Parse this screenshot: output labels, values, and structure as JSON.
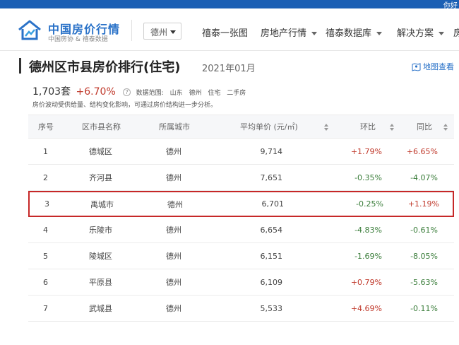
{
  "topbar": {
    "greeting": "你好"
  },
  "header": {
    "brand": "中国房价行情",
    "brand_sub": "中国房协 & 禧泰数据",
    "city_selected": "德州",
    "nav": [
      {
        "label": "禧泰一张图",
        "dropdown": false
      },
      {
        "label": "房地产行情",
        "dropdown": true
      },
      {
        "label": "禧泰数据库",
        "dropdown": true
      },
      {
        "label": "解决方案",
        "dropdown": true
      },
      {
        "label": "房",
        "dropdown": false
      }
    ]
  },
  "page": {
    "title": "德州区市县房价排行(住宅)",
    "date": "2021年01月",
    "map_link": "地图查看",
    "summary": {
      "count": "1,703套",
      "change": "+6.70%",
      "scope_label": "数据范围:",
      "scope": [
        "山东",
        "德州",
        "住宅",
        "二手房"
      ]
    },
    "note": "房价波动受供给量、结构变化影响，可通过房价结构进一步分析。"
  },
  "table": {
    "headers": {
      "rank": "序号",
      "area": "区市县名称",
      "city": "所属城市",
      "price": "平均单价 (元/㎡)",
      "mom": "环比",
      "yoy": "同比"
    },
    "rows": [
      {
        "rank": "1",
        "area": "德城区",
        "city": "德州",
        "price": "9,714",
        "mom": "+1.79%",
        "yoy": "+6.65%"
      },
      {
        "rank": "2",
        "area": "齐河县",
        "city": "德州",
        "price": "7,651",
        "mom": "-0.35%",
        "yoy": "-4.07%"
      },
      {
        "rank": "3",
        "area": "禹城市",
        "city": "德州",
        "price": "6,701",
        "mom": "-0.25%",
        "yoy": "+1.19%"
      },
      {
        "rank": "4",
        "area": "乐陵市",
        "city": "德州",
        "price": "6,654",
        "mom": "-4.83%",
        "yoy": "-0.61%"
      },
      {
        "rank": "5",
        "area": "陵城区",
        "city": "德州",
        "price": "6,151",
        "mom": "-1.69%",
        "yoy": "-8.05%"
      },
      {
        "rank": "6",
        "area": "平原县",
        "city": "德州",
        "price": "6,109",
        "mom": "+0.79%",
        "yoy": "-5.63%"
      },
      {
        "rank": "7",
        "area": "武城县",
        "city": "德州",
        "price": "5,533",
        "mom": "+4.69%",
        "yoy": "-0.11%"
      }
    ]
  },
  "colors": {
    "brand_blue": "#2a72c8",
    "topbar_blue": "#1a5fb4",
    "positive": "#c0392b",
    "negative": "#3a7d3a",
    "highlight_border": "#c62828"
  }
}
